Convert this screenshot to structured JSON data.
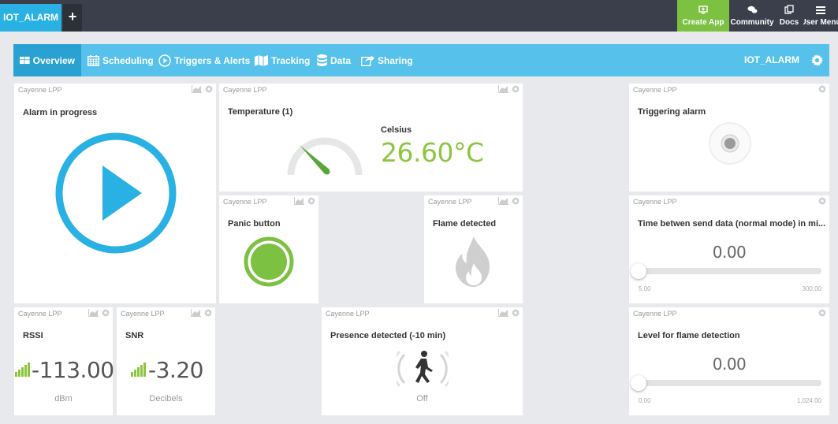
{
  "topbar": {
    "project_tab": "IOT_ALARM",
    "add_tab": "+",
    "create_app": "Create App",
    "community": "Community",
    "docs": "Docs",
    "user_menu": "User Menu"
  },
  "nav": {
    "overview": "Overview",
    "scheduling": "Scheduling",
    "triggers": "Triggers & Alerts",
    "tracking": "Tracking",
    "data": "Data",
    "sharing": "Sharing",
    "project_name": "IOT_ALARM"
  },
  "colors": {
    "accent": "#29b1e3",
    "nav": "#56c1ea",
    "green": "#7cc142",
    "topbar": "#3a3f4b"
  },
  "widgets": {
    "alarm": {
      "source": "Cayenne LPP",
      "title": "Alarm in progress"
    },
    "temperature": {
      "source": "Cayenne LPP",
      "title": "Temperature (1)",
      "unit_label": "Celsius",
      "value": "26.60°C"
    },
    "triggering": {
      "source": "Cayenne LPP",
      "title": "Triggering alarm"
    },
    "panic": {
      "source": "Cayenne LPP",
      "title": "Panic button"
    },
    "flame": {
      "source": "Cayenne LPP",
      "title": "Flame detected"
    },
    "timebetween": {
      "source": "Cayenne LPP",
      "title": "Time betwen send data (normal mode) in mi...",
      "value": "0.00",
      "min": "5.00",
      "max": "300.00"
    },
    "rssi": {
      "source": "Cayenne LPP",
      "title": "RSSI",
      "value": "-113.00",
      "unit": "dBm"
    },
    "snr": {
      "source": "Cayenne LPP",
      "title": "SNR",
      "value": "-3.20",
      "unit": "Decibels"
    },
    "presence": {
      "source": "Cayenne LPP",
      "title": "Presence detected (-10 min)",
      "state": "Off"
    },
    "flamelevel": {
      "source": "Cayenne LPP",
      "title": "Level for flame detection",
      "value": "0.00",
      "min": "0.00",
      "max": "1,024.00"
    }
  }
}
